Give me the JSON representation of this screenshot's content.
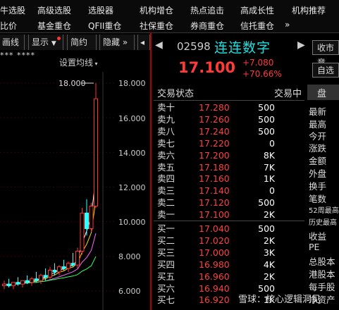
{
  "nav": {
    "row1": [
      "牛选股",
      "高级选股",
      "选股器",
      "机构增仓",
      "热点追击",
      "高成长性",
      "机构推荐"
    ],
    "row2": [
      "比价",
      "基金重仓",
      "QFII重仓",
      "社保重仓",
      "券商重仓",
      "信托重仓"
    ],
    "more1": "◀▶",
    "more2": "»"
  },
  "toolbar": {
    "draw": "画线",
    "show": "显示",
    "brief": "简约",
    "hide": "隐藏"
  },
  "chart": {
    "stars": "*** ****",
    "settings": "设置均线",
    "max_label": "18.000",
    "yticks": [
      "18.000",
      "16.000",
      "14.000",
      "12.000",
      "10.000",
      "8.000",
      "6.000"
    ]
  },
  "chart_data": {
    "type": "candlestick",
    "y_range": [
      6.0,
      18.5
    ],
    "candles": [
      {
        "o": 6.3,
        "h": 6.6,
        "l": 6.1,
        "c": 6.4
      },
      {
        "o": 6.4,
        "h": 6.7,
        "l": 6.2,
        "c": 6.3
      },
      {
        "o": 6.3,
        "h": 6.5,
        "l": 6.1,
        "c": 6.5
      },
      {
        "o": 6.5,
        "h": 6.8,
        "l": 6.3,
        "c": 6.4
      },
      {
        "o": 6.4,
        "h": 6.6,
        "l": 6.2,
        "c": 6.6
      },
      {
        "o": 6.6,
        "h": 6.9,
        "l": 6.4,
        "c": 6.5
      },
      {
        "o": 6.5,
        "h": 6.8,
        "l": 6.3,
        "c": 6.7
      },
      {
        "o": 6.7,
        "h": 7.1,
        "l": 6.5,
        "c": 6.6
      },
      {
        "o": 6.6,
        "h": 7.0,
        "l": 6.4,
        "c": 6.9
      },
      {
        "o": 6.9,
        "h": 7.3,
        "l": 6.6,
        "c": 6.8
      },
      {
        "o": 6.8,
        "h": 7.4,
        "l": 6.7,
        "c": 7.2
      },
      {
        "o": 7.2,
        "h": 7.6,
        "l": 6.9,
        "c": 7.1
      },
      {
        "o": 7.1,
        "h": 7.5,
        "l": 6.9,
        "c": 7.4
      },
      {
        "o": 7.4,
        "h": 7.8,
        "l": 7.2,
        "c": 7.3
      },
      {
        "o": 7.3,
        "h": 7.7,
        "l": 7.1,
        "c": 7.6
      },
      {
        "o": 7.6,
        "h": 8.2,
        "l": 7.4,
        "c": 7.5
      },
      {
        "o": 7.5,
        "h": 8.5,
        "l": 7.3,
        "c": 8.3
      },
      {
        "o": 8.3,
        "h": 10.8,
        "l": 8.1,
        "c": 10.5
      },
      {
        "o": 10.5,
        "h": 11.3,
        "l": 9.2,
        "c": 9.6
      },
      {
        "o": 9.6,
        "h": 11.1,
        "l": 9.4,
        "c": 10.9
      },
      {
        "o": 10.9,
        "h": 18.0,
        "l": 10.8,
        "c": 17.1
      }
    ]
  },
  "quote": {
    "code": "02598",
    "name": "连连数字",
    "price": "17.100",
    "change": "+7.080",
    "pct": "+70.66%",
    "btn_market": "收市竞",
    "btn_fav": "自选"
  },
  "orderbook": {
    "col1": "交易状态",
    "col2": "交易中",
    "asks": [
      {
        "label": "卖十",
        "price": "17.280",
        "vol": "500"
      },
      {
        "label": "卖九",
        "price": "17.260",
        "vol": "500"
      },
      {
        "label": "卖八",
        "price": "17.240",
        "vol": "500"
      },
      {
        "label": "卖七",
        "price": "17.220",
        "vol": "0"
      },
      {
        "label": "卖六",
        "price": "17.200",
        "vol": "8K"
      },
      {
        "label": "卖五",
        "price": "17.180",
        "vol": "7K"
      },
      {
        "label": "卖四",
        "price": "17.160",
        "vol": "1K"
      },
      {
        "label": "卖三",
        "price": "17.140",
        "vol": "0"
      },
      {
        "label": "卖二",
        "price": "17.120",
        "vol": "500"
      },
      {
        "label": "卖一",
        "price": "17.100",
        "vol": "2K"
      }
    ],
    "bids": [
      {
        "label": "买一",
        "price": "17.040",
        "vol": "500"
      },
      {
        "label": "买二",
        "price": "17.020",
        "vol": "2K"
      },
      {
        "label": "买三",
        "price": "17.000",
        "vol": "3K"
      },
      {
        "label": "买四",
        "price": "16.980",
        "vol": "4K"
      },
      {
        "label": "买五",
        "price": "16.960",
        "vol": "2K"
      },
      {
        "label": "买六",
        "price": "16.940",
        "vol": "500"
      },
      {
        "label": "买七",
        "price": "16.920",
        "vol": "1K"
      }
    ]
  },
  "stats": {
    "items": [
      "最新",
      "最高",
      "今开",
      "涨跌",
      "金额",
      "外盘",
      "换手",
      "笔数",
      "52周最高",
      "历史最高",
      "收益",
      "PE",
      "总股本",
      "港股本",
      "每手股",
      "净资产"
    ]
  },
  "watermark": "雪球：核心逻辑洞见"
}
